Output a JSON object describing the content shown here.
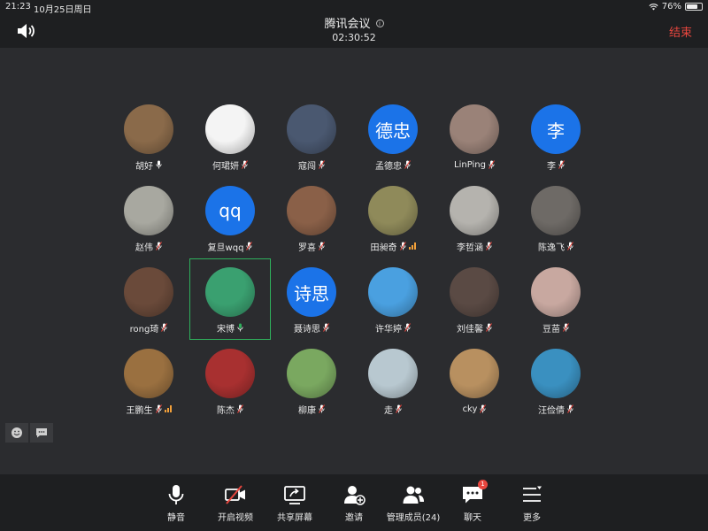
{
  "status": {
    "time": "21:23",
    "date": "10月25日周日",
    "battery": "76%",
    "battery_level": 0.76
  },
  "header": {
    "title": "腾讯会议",
    "timer": "02:30:52",
    "end_label": "结束"
  },
  "participants": [
    {
      "name": "胡好",
      "mic": "on",
      "signal": false,
      "avatar": "photo",
      "color": "#8a6a4a"
    },
    {
      "name": "何珺妍",
      "mic": "muted",
      "signal": false,
      "avatar": "photo",
      "color": "#f4f4f4"
    },
    {
      "name": "寇闯",
      "mic": "muted",
      "signal": false,
      "avatar": "photo",
      "color": "#4a5870"
    },
    {
      "name": "孟德忠",
      "mic": "muted",
      "signal": false,
      "avatar": "letter",
      "initials": "德忠"
    },
    {
      "name": "LinPing",
      "mic": "muted",
      "signal": false,
      "avatar": "photo",
      "color": "#9a8278"
    },
    {
      "name": "李",
      "mic": "muted",
      "signal": false,
      "avatar": "letter",
      "initials": "李"
    },
    {
      "name": "赵伟",
      "mic": "muted",
      "signal": false,
      "avatar": "photo",
      "color": "#a8a8a0"
    },
    {
      "name": "复旦wqq",
      "mic": "muted",
      "signal": false,
      "avatar": "letter",
      "initials": "qq"
    },
    {
      "name": "罗喜",
      "mic": "muted",
      "signal": false,
      "avatar": "photo",
      "color": "#8a6048"
    },
    {
      "name": "田昶奇",
      "mic": "muted",
      "signal": true,
      "avatar": "photo",
      "color": "#8f8a5a"
    },
    {
      "name": "李哲涵",
      "mic": "muted",
      "signal": false,
      "avatar": "photo",
      "color": "#b5b3ae"
    },
    {
      "name": "陈逸飞",
      "mic": "muted",
      "signal": false,
      "avatar": "photo",
      "color": "#6e6a66"
    },
    {
      "name": "rong琦",
      "mic": "muted",
      "signal": false,
      "avatar": "photo",
      "color": "#6a4a3a"
    },
    {
      "name": "宋博",
      "mic": "on",
      "signal": false,
      "avatar": "photo",
      "color": "#3aa070",
      "active": true
    },
    {
      "name": "聂诗思",
      "mic": "muted",
      "signal": false,
      "avatar": "letter",
      "initials": "诗思"
    },
    {
      "name": "许华婷",
      "mic": "muted",
      "signal": false,
      "avatar": "photo",
      "color": "#4aa0e0"
    },
    {
      "name": "刘佳馨",
      "mic": "muted",
      "signal": false,
      "avatar": "photo",
      "color": "#5a4a44"
    },
    {
      "name": "豆苗",
      "mic": "muted",
      "signal": false,
      "avatar": "photo",
      "color": "#c8a8a0"
    },
    {
      "name": "王鹏生",
      "mic": "muted",
      "signal": true,
      "avatar": "photo",
      "color": "#9a7040"
    },
    {
      "name": "陈杰",
      "mic": "muted",
      "signal": false,
      "avatar": "photo",
      "color": "#a83030"
    },
    {
      "name": "柳康",
      "mic": "muted",
      "signal": false,
      "avatar": "photo",
      "color": "#7aa860"
    },
    {
      "name": "走",
      "mic": "muted",
      "signal": false,
      "avatar": "photo",
      "color": "#b8c8d0"
    },
    {
      "name": "cky",
      "mic": "muted",
      "signal": false,
      "avatar": "photo",
      "color": "#b89060"
    },
    {
      "name": "汪俭倩",
      "mic": "muted",
      "signal": false,
      "avatar": "photo",
      "color": "#3a90c0"
    }
  ],
  "toolbar": {
    "mute": "静音",
    "video": "开启视频",
    "share": "共享屏幕",
    "invite": "邀请",
    "members": "管理成员(24)",
    "chat": "聊天",
    "chat_badge": "1",
    "more": "更多"
  },
  "colors": {
    "accent_blue": "#1b73e8",
    "end_red": "#e8463e",
    "speaker_green": "#2fb05c",
    "mic_muted_red": "#e8463e"
  }
}
